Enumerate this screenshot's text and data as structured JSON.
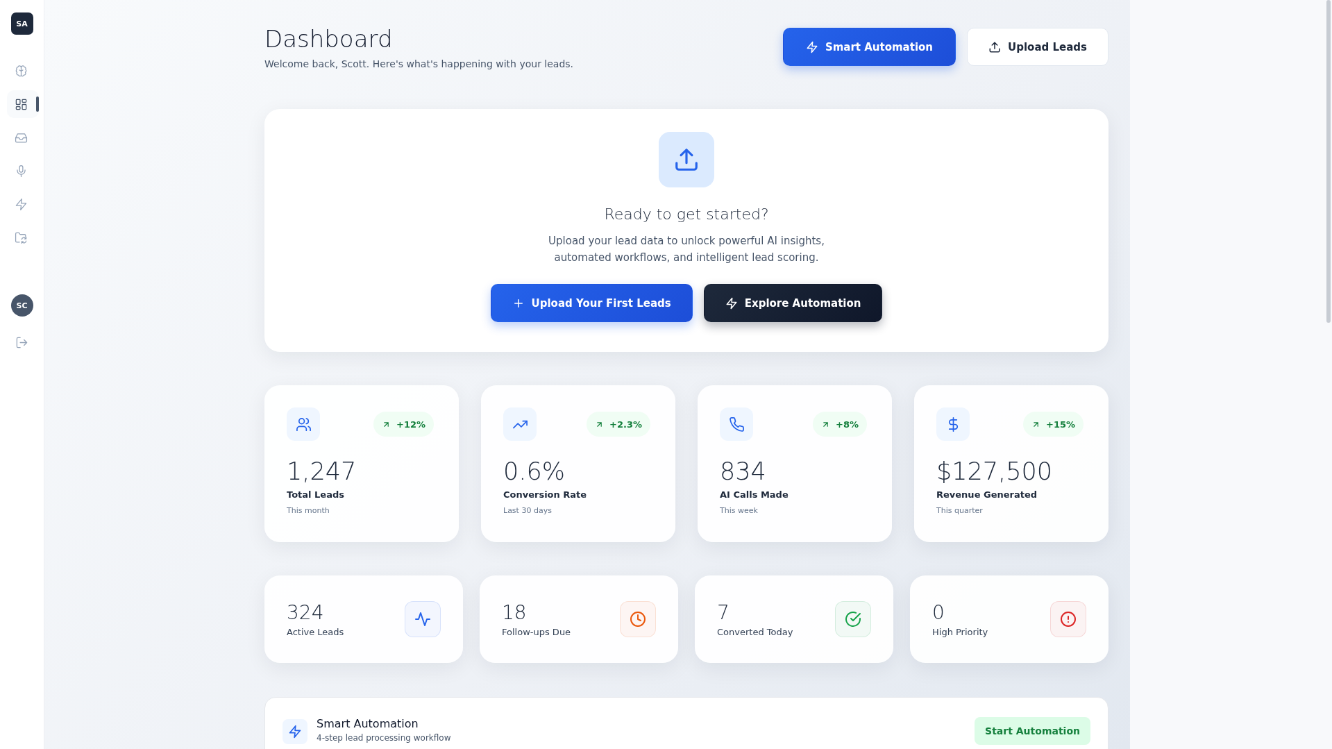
{
  "sidebar": {
    "logo": "SA",
    "items": [
      {
        "kind": "brain",
        "selected": false
      },
      {
        "kind": "grid",
        "selected": true
      },
      {
        "kind": "inbox",
        "selected": false
      },
      {
        "kind": "mic",
        "selected": false
      },
      {
        "kind": "zap",
        "selected": false
      },
      {
        "kind": "folder-sync",
        "selected": false
      }
    ],
    "user_avatar": "SC"
  },
  "header": {
    "title": "Dashboard",
    "subtitle": "Welcome back, Scott. Here's what's happening with your leads.",
    "buttons": [
      {
        "label": "Smart Automation",
        "kind": "primary"
      },
      {
        "label": "Upload Leads",
        "kind": "outline"
      }
    ]
  },
  "hero": {
    "heading": "Ready to get started?",
    "text_lines": [
      "Upload your lead data to unlock powerful AI insights,",
      "automated workflows, and intelligent lead scoring."
    ],
    "buttons": [
      {
        "label": "Upload Your First Leads",
        "kind": "primary"
      },
      {
        "label": "Explore Automation",
        "kind": "dark"
      }
    ]
  },
  "stats": [
    {
      "change": "+12%",
      "value": "1,247",
      "label": "Total Leads",
      "period": "This month"
    },
    {
      "change": "+2.3%",
      "value": "0.6%",
      "label": "Conversion Rate",
      "period": "Last 30 days"
    },
    {
      "change": "+8%",
      "value": "834",
      "label": "AI Calls Made",
      "period": "This week"
    },
    {
      "change": "+15%",
      "value": "$127,500",
      "label": "Revenue Generated",
      "period": "This quarter"
    }
  ],
  "mini_stats": [
    {
      "value": "324",
      "label": "Active Leads",
      "color": "#2563eb"
    },
    {
      "value": "18",
      "label": "Follow-ups Due",
      "color": "#ea580c"
    },
    {
      "value": "7",
      "label": "Converted Today",
      "color": "#16a34a"
    },
    {
      "value": "0",
      "label": "High Priority",
      "color": "#dc2626"
    }
  ],
  "automation": {
    "title": "Smart Automation",
    "subtitle": "4-step lead processing workflow",
    "button": "Start Automation"
  }
}
